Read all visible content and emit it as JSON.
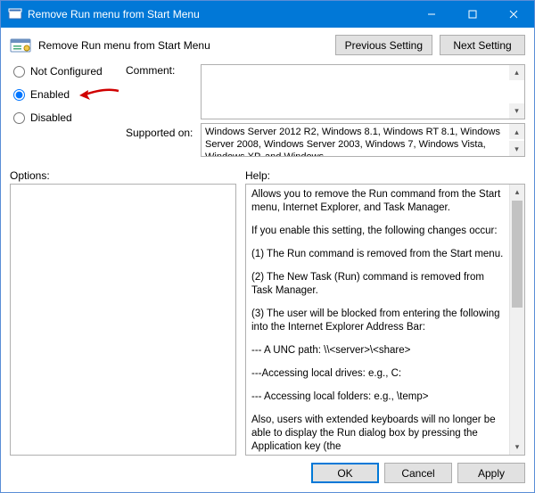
{
  "window": {
    "title": "Remove Run menu from Start Menu"
  },
  "header": {
    "policy_title": "Remove Run menu from Start Menu",
    "btn_prev": "Previous Setting",
    "btn_next": "Next Setting"
  },
  "config": {
    "radios": {
      "not_configured": "Not Configured",
      "enabled": "Enabled",
      "disabled": "Disabled",
      "selected": "enabled"
    },
    "comment_label": "Comment:",
    "comment_value": "",
    "supported_label": "Supported on:",
    "supported_value": "Windows Server 2012 R2, Windows 8.1, Windows RT 8.1, Windows Server 2008, Windows Server 2003, Windows 7, Windows Vista, Windows XP, and Windows"
  },
  "labels": {
    "options": "Options:",
    "help": "Help:"
  },
  "help": {
    "p1": "Allows you to remove the Run command from the Start menu, Internet Explorer, and Task Manager.",
    "p2": "If you enable this setting, the following changes occur:",
    "p3": "(1) The Run command is removed from the Start menu.",
    "p4": "(2) The New Task (Run) command is removed from Task Manager.",
    "p5": "(3) The user will be blocked from entering the following into the Internet Explorer Address Bar:",
    "p6": "--- A UNC path: \\\\<server>\\<share>",
    "p7": "---Accessing local drives:  e.g., C:",
    "p8": "--- Accessing local folders: e.g., \\temp>",
    "p9": "Also, users with extended keyboards will no longer be able to display the Run dialog box by pressing the Application key (the"
  },
  "bottom": {
    "ok": "OK",
    "cancel": "Cancel",
    "apply": "Apply"
  }
}
